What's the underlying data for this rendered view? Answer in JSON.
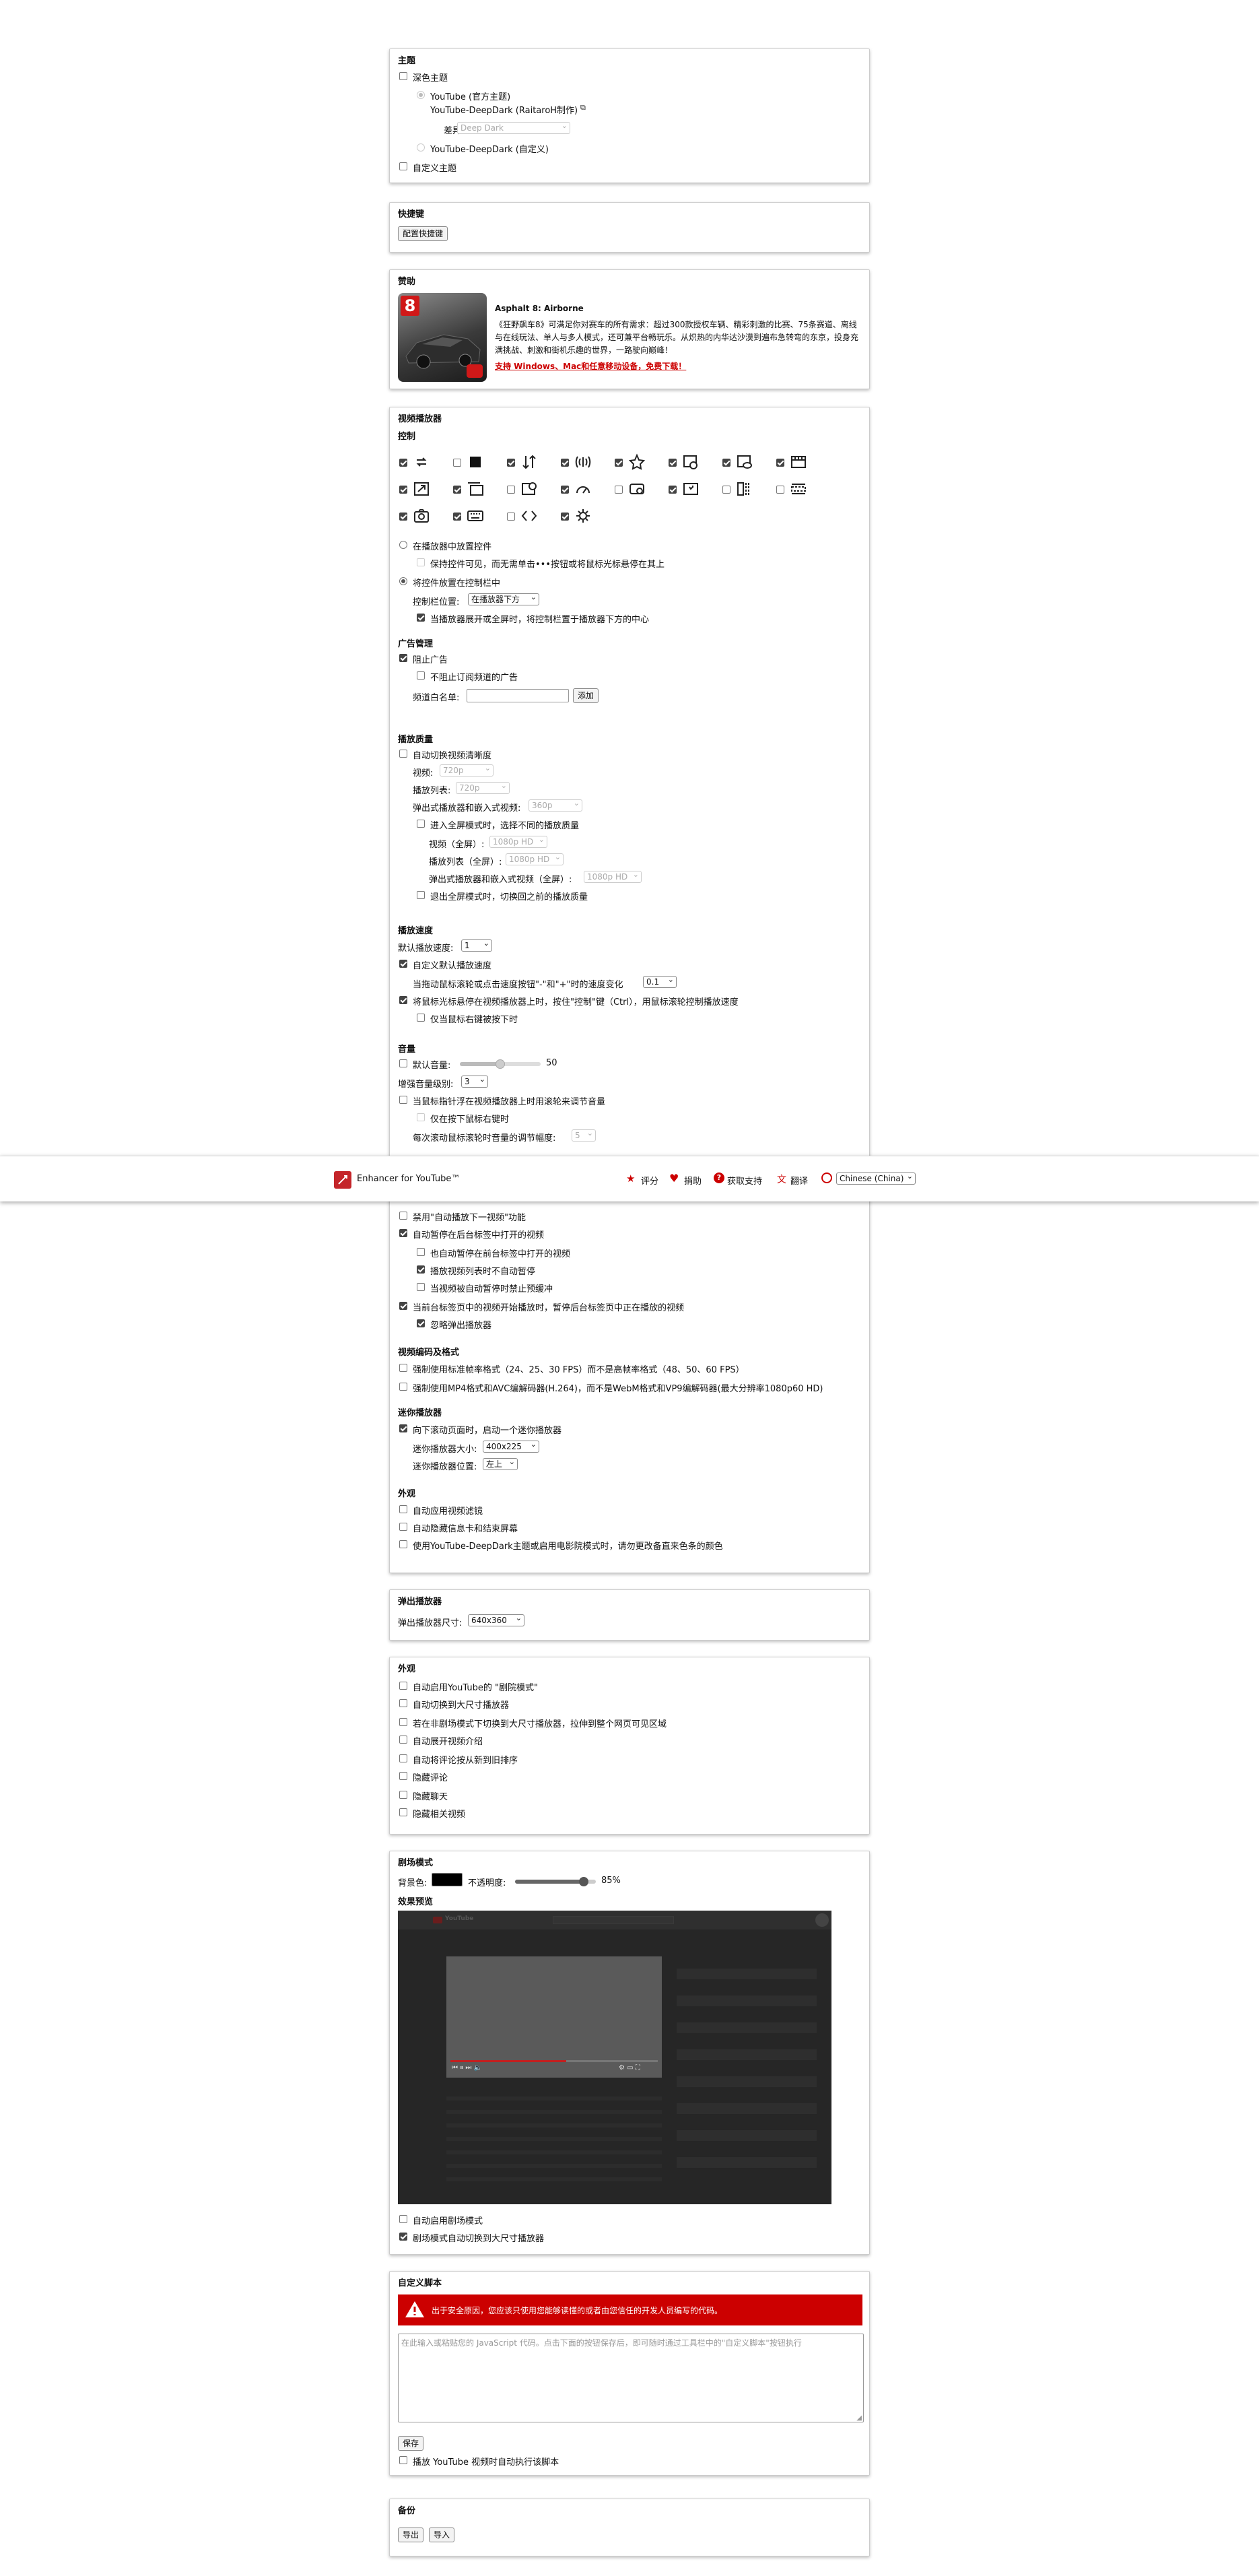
{
  "theme": {
    "title": "主题",
    "dark": "深色主题",
    "yt_official": "YouTube (官方主题)",
    "yt_deepdark": "YouTube-DeepDark (RaitaroH制作)",
    "variant_label": "差异:",
    "variant_value": "Deep Dark",
    "yt_custom": "YouTube-DeepDark (自定义)",
    "custom": "自定义主题"
  },
  "shortcuts": {
    "title": "快捷键",
    "configure": "配置快捷键"
  },
  "sponsor": {
    "title": "赞助",
    "app_name": "Asphalt 8: Airborne",
    "desc": "《狂野飙车8》可满足你对赛车的所有需求：超过300款授权车辆、精彩刺激的比赛、75条赛道、离线与在线玩法、单人与多人模式，还可兼平台畅玩乐。从炽热的内华达沙漠到遍布急转弯的东京，投身充满挑战、刺激和街机乐趣的世界，一路驶向巅峰！",
    "link": "支持 Windows、Mac和任意移动设备，免费下载！",
    "badge": "8"
  },
  "player": {
    "title": "视频播放器",
    "controls": "控制",
    "place_in_player": "在播放器中放置控件",
    "keep_visible": "保持控件可见，而无需单击•••按钮或将鼠标光标悬停在其上",
    "place_in_bar": "将控件放置在控制栏中",
    "bar_pos_label": "控制栏位置:",
    "bar_pos_value": "在播放器下方",
    "center_fullscreen": "当播放器展开或全屏时，将控制栏置于播放器下方的中心"
  },
  "ads": {
    "title": "广告管理",
    "block": "阻止广告",
    "no_block_sub": "不阻止订阅频道的广告",
    "whitelist_label": "频道白名单:",
    "add": "添加"
  },
  "quality": {
    "title": "播放质量",
    "auto": "自动切换视频清晰度",
    "video_label": "视频:",
    "video_value": "720p",
    "playlist_label": "播放列表:",
    "playlist_value": "720p",
    "popup_label": "弹出式播放器和嵌入式视频:",
    "popup_value": "360p",
    "fs_diff": "进入全屏模式时，选择不同的播放质量",
    "fs_video_label": "视频（全屏）:",
    "fs_video_value": "1080p HD",
    "fs_playlist_label": "播放列表（全屏）:",
    "fs_playlist_value": "1080p HD",
    "fs_popup_label": "弹出式播放器和嵌入式视频（全屏）:",
    "fs_popup_value": "1080p HD",
    "fs_restore": "退出全屏模式时，切换回之前的播放质量"
  },
  "speed": {
    "title": "播放速度",
    "default_label": "默认播放速度:",
    "default_value": "1",
    "custom_default": "自定义默认播放速度",
    "step_label": "当拖动鼠标滚轮或点击速度按钮\"-\"和\"+\"时的速度变化",
    "step_value": "0.1",
    "wheel": "将鼠标光标悬停在视频播放器上时，按住\"控制\"键（Ctrl），用鼠标滚轮控制播放速度",
    "only_right": "仅当鼠标右键被按下时"
  },
  "volume": {
    "title": "音量",
    "default_label": "默认音量:",
    "default_value": "50",
    "default_level": 0.5,
    "boost_label": "增强音量级别:",
    "boost_value": "3",
    "wheel": "当鼠标指针浮在视频播放器上时用滚轮来调节音量",
    "only_right": "仅在按下鼠标右键时",
    "step_label": "每次滚动鼠标滚轮时音量的调节幅度:",
    "step_value": "5"
  },
  "autoplay": {
    "disable_next": "禁用\"自动播放下一视频\"功能",
    "pause_bg": "自动暂停在后台标签中打开的视频",
    "pause_fg": "也自动暂停在前台标签中打开的视频",
    "no_pause_playlist": "播放视频列表时不自动暂停",
    "prevent_preload": "当视频被自动暂停时禁止预缓冲",
    "pause_others": "当前台标签页中的视频开始播放时，暂停后台标签页中正在播放的视频",
    "ignore_popup": "忽略弹出播放器"
  },
  "codecs": {
    "title": "视频编码及格式",
    "force_std": "强制使用标准帧率格式（24、25、30 FPS）而不是高帧率格式（48、50、60 FPS）",
    "force_mp4": "强制使用MP4格式和AVC编解码器(H.264)，而不是WebM格式和VP9编解码器(最大分辨率1080p60 HD)"
  },
  "mini": {
    "title": "迷你播放器",
    "enable": "向下滚动页面时，启动一个迷你播放器",
    "size_label": "迷你播放器大小:",
    "size_value": "400x225",
    "pos_label": "迷你播放器位置:",
    "pos_value": "左上"
  },
  "appearance1": {
    "title": "外观",
    "filters": "自动应用视频滤镜",
    "hide_cards": "自动隐藏信息卡和结束屏幕",
    "deepdark_note": "使用YouTube-DeepDark主题或启用电影院模式时，请勿更改备直来色条的颜色"
  },
  "topbar": {
    "brand": "Enhancer for YouTube™",
    "rate": "评分",
    "donate": "捐助",
    "support": "获取支持",
    "translate": "翻译",
    "lang": "Chinese (China)"
  },
  "popup": {
    "title": "弹出播放器",
    "size_label": "弹出播放器尺寸:",
    "size_value": "640x360"
  },
  "appearance2": {
    "title": "外观",
    "theater": "自动启用YouTube的 \"剧院模式\"",
    "auto_large": "自动切换到大尺寸播放器",
    "fill_window": "若在非剧场模式下切换到大尺寸播放器，拉伸到整个网页可见区域",
    "expand_desc": "自动展开视频介绍",
    "sort_comments": "自动将评论按从新到旧排序",
    "hide_comments": "隐藏评论",
    "hide_chat": "隐藏聊天",
    "hide_related": "隐藏相关视频"
  },
  "cinema": {
    "title": "剧场模式",
    "bg_label": "背景色:",
    "opacity_label": "不透明度:",
    "opacity_value": "85%",
    "opacity_level": 0.85,
    "preview_title": "效果预览",
    "auto_enable": "自动启用剧场模式",
    "auto_large": "剧场模式自动切换到大尺寸播放器",
    "bg_color": "#000000",
    "preview_logo": "YouTube",
    "video_progress": 0.56
  },
  "script": {
    "title": "自定义脚本",
    "warning": "出于安全原因，您应该只使用您能够读懂的或者由您信任的开发人员编写的代码。",
    "placeholder": "在此输入或粘贴您的 JavaScript 代码。点击下面的按钮保存后，即可随时通过工具栏中的\"自定义脚本\"按钮执行",
    "save": "保存",
    "autorun": "播放 YouTube 视频时自动执行该脚本",
    "warn_color": "#cc0000"
  },
  "backup": {
    "title": "备份",
    "export": "导出",
    "import": "导入"
  }
}
